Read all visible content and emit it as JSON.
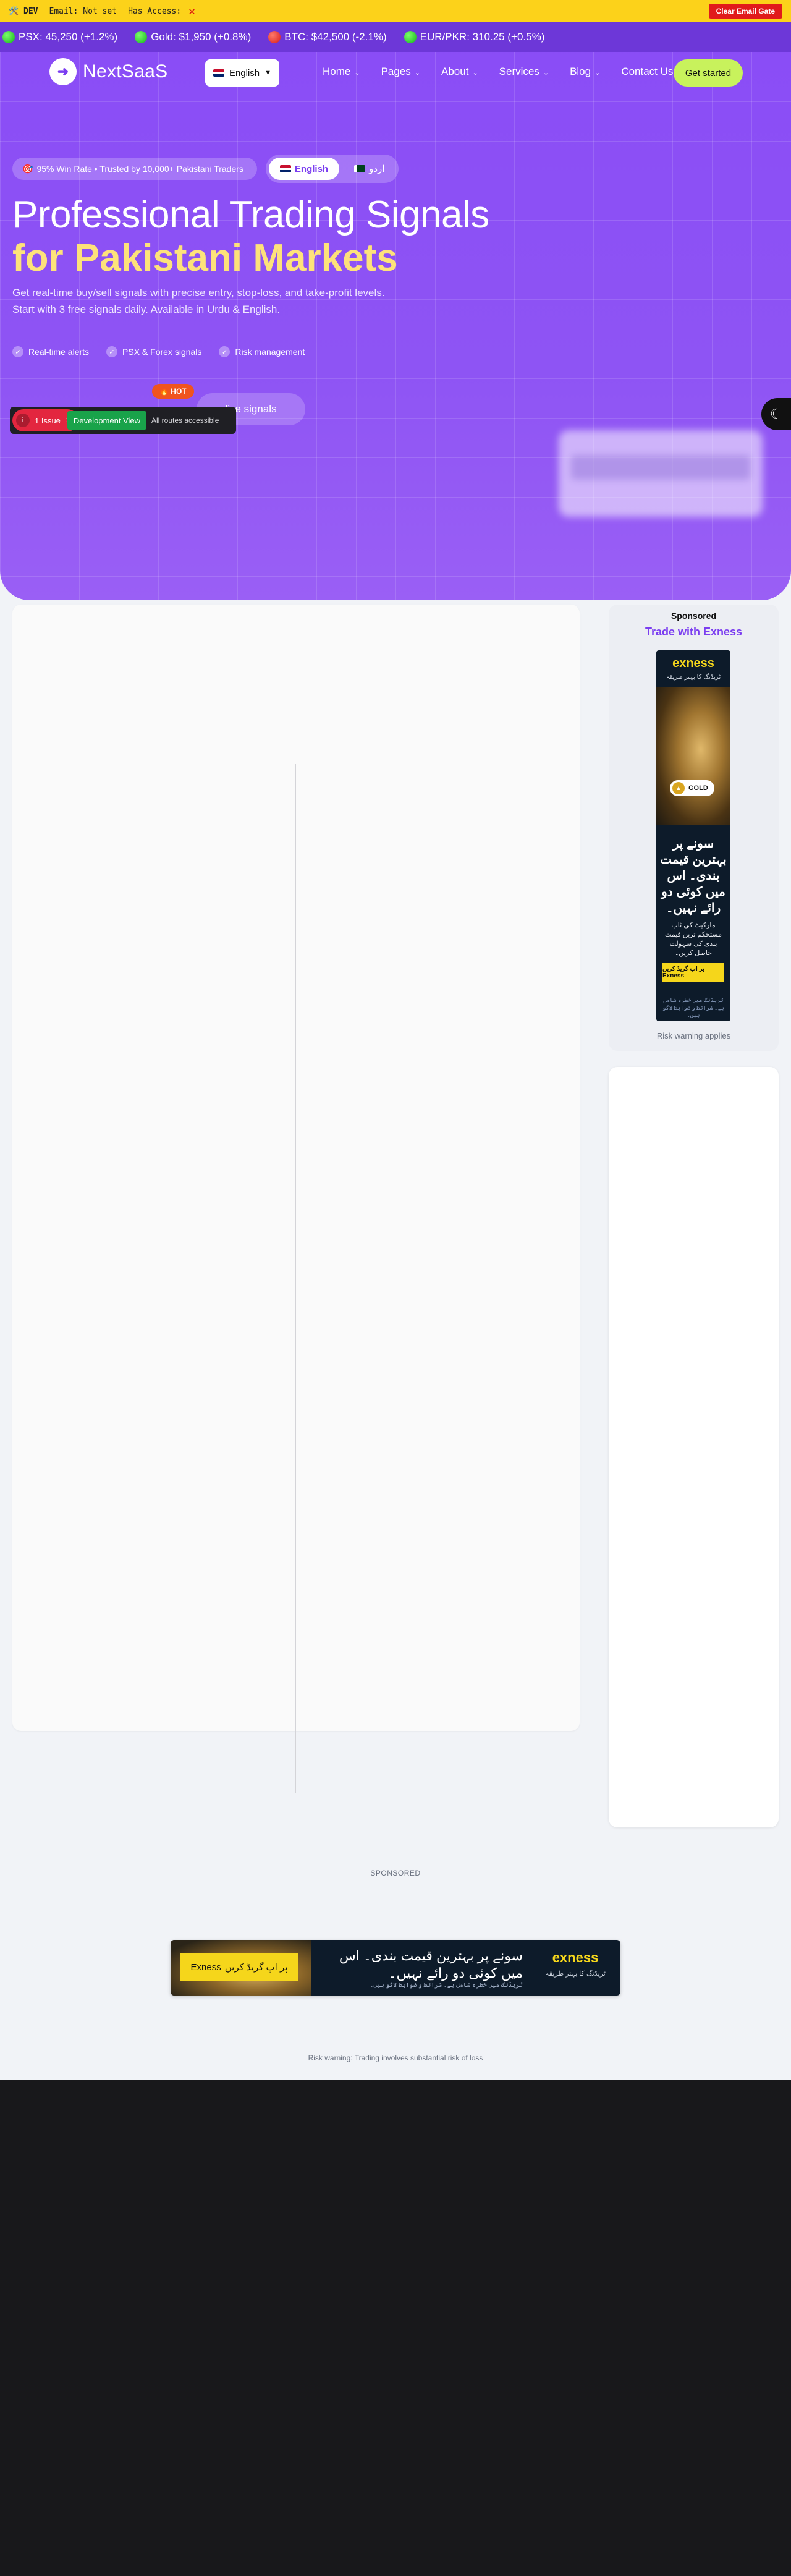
{
  "devbar": {
    "tag": "🛠️ DEV",
    "email": "Email: Not set",
    "access": "Has Access:",
    "access_mark": "✕",
    "clear_label": "Clear Email Gate"
  },
  "ticker": [
    {
      "label": "PSX: 45,250 (+1.2%)",
      "trend": "up"
    },
    {
      "label": "Gold: $1,950 (+0.8%)",
      "trend": "up"
    },
    {
      "label": "BTC: $42,500 (-2.1%)",
      "trend": "down"
    },
    {
      "label": "EUR/PKR: 310.25 (+0.5%)",
      "trend": "up"
    }
  ],
  "nav": {
    "logo_text": "NextSaaS",
    "language": "English",
    "menu": [
      "Home",
      "Pages",
      "About",
      "Services",
      "Blog",
      "Contact Us"
    ],
    "cta": "Get started"
  },
  "hero": {
    "trust": "95% Win Rate • Trusted by 10,000+ Pakistani Traders",
    "toggle_en": "English",
    "toggle_ur": "اردو",
    "title_line1": "Professional Trading Signals",
    "title_line2": "for Pakistani Markets",
    "subtitle": "Get real-time buy/sell signals with precise entry, stop-loss, and take-profit levels. Start with 3 free signals daily. Available in Urdu & English.",
    "features": [
      "Real-time alerts",
      "PSX & Forex signals",
      "Risk management"
    ],
    "hot_badge": "🔥 HOT",
    "live_button": "live signals"
  },
  "devtools": {
    "issues": "1 Issue",
    "issue_icon": "i",
    "mode": "Development View",
    "routes": "All routes accessible"
  },
  "sidebar_ad": {
    "sponsored": "Sponsored",
    "title": "Trade with Exness",
    "brand": "exness",
    "brand_sub": "ٹریڈنگ کا بہتر طریقہ",
    "gold_label": "GOLD",
    "headline": "سونے پر بہترین قیمت بندی۔ اس میں کوئی دو رائے نہیں۔",
    "body": "مارکیٹ کی ٹاپ مستحکم ترین قیمت بندی کی سہولت حاصل کریں۔",
    "button": "پر اپ گریڈ کریں Exness",
    "small": "ٹریڈنگ میں خطرہ شامل ہے۔ شرائط و ضوابط لاگو ہیں۔",
    "risk": "Risk warning applies"
  },
  "bottom_ad": {
    "label": "SPONSORED",
    "button": "پر اپ گریڈ کریں",
    "button_brand": "Exness",
    "headline": "سونے پر بہترین قیمت بندی۔ اس میں کوئی دو رائے نہیں۔",
    "small": "ٹریڈنگ میں خطرہ شامل ہے۔ شرائط و ضوابط لاگو ہیں۔",
    "brand": "exness",
    "brand_sub": "ٹریڈنگ کا بہتر طریقہ",
    "risk": "Risk warning: Trading involves substantial risk of loss"
  },
  "icons": {
    "logo": "arrow-right-icon",
    "chevron": "chevron-down-icon",
    "check": "check-icon",
    "theme": "moon-icon",
    "close": "close-icon"
  },
  "colors": {
    "accent": "#8a4cf6",
    "devbar": "#fcd21a",
    "cta": "#c8f25c",
    "title_highlight": "#fde27a",
    "brand_yellow": "#f5d61b",
    "footer": "#18181b"
  }
}
